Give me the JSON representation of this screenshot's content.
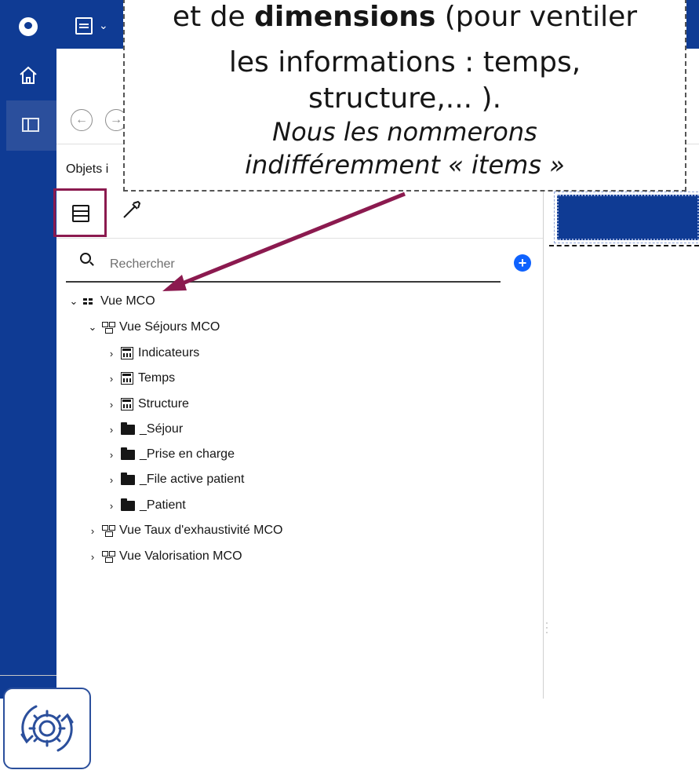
{
  "callout": {
    "line1_prefix": "et de ",
    "line1_bold": "dimensions",
    "line1_suffix": " (pour ventiler",
    "line2": "les informations : temps,",
    "line3": "structure,... ).",
    "line4": "Nous les nommerons",
    "line5": "indifféremment « items »",
    "accent_color": "#8b1a4f"
  },
  "rail": {
    "color": "#0f3b94",
    "home_icon": "home-icon",
    "panel_icon": "side-panel-icon",
    "logo_icon": "app-logo-icon"
  },
  "toolbar": {
    "save_icon": "save-icon",
    "save_caret": "⌄",
    "back_glyph": "←",
    "forward_glyph": "→"
  },
  "panel": {
    "title": "Objets i",
    "tabs": [
      {
        "name": "data-items-tab",
        "icon": "database-icon",
        "selected": true
      },
      {
        "name": "tools-tab",
        "icon": "hammer-icon",
        "selected": false
      }
    ]
  },
  "search": {
    "placeholder": "Rechercher",
    "add_glyph": "+"
  },
  "tree": {
    "root": {
      "label": "Vue MCO",
      "expanded": true,
      "chevron": "⌄"
    },
    "sejours": {
      "label": "Vue Séjours MCO",
      "expanded": true,
      "chevron": "⌄"
    },
    "items": [
      {
        "label": "Indicateurs",
        "icon": "measure-dimension-icon",
        "chevron": "›"
      },
      {
        "label": "Temps",
        "icon": "measure-dimension-icon",
        "chevron": "›"
      },
      {
        "label": "Structure",
        "icon": "measure-dimension-icon",
        "chevron": "›"
      },
      {
        "label": "_Séjour",
        "icon": "folder-icon",
        "chevron": "›"
      },
      {
        "label": "_Prise en charge",
        "icon": "folder-icon",
        "chevron": "›"
      },
      {
        "label": "_File active patient",
        "icon": "folder-icon",
        "chevron": "›"
      },
      {
        "label": "_Patient",
        "icon": "folder-icon",
        "chevron": "›"
      }
    ],
    "siblings": [
      {
        "label": "Vue Taux d'exhaustivité MCO",
        "chevron": "›"
      },
      {
        "label": "Vue Valorisation MCO",
        "chevron": "›"
      }
    ]
  },
  "bottom_widget": {
    "icon": "settings-refresh-icon"
  }
}
